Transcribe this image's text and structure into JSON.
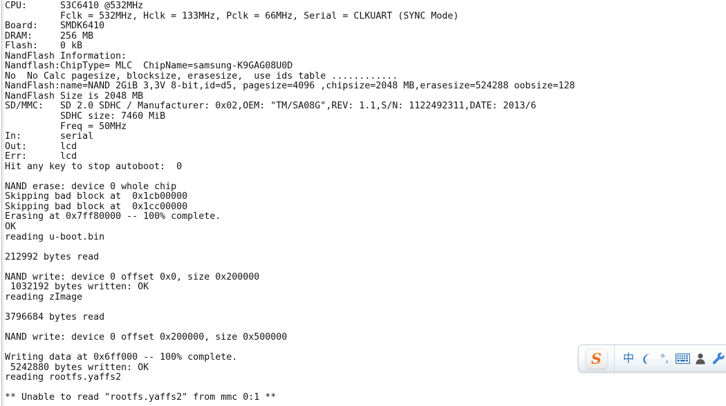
{
  "window": {
    "kind": "serial-terminal-console",
    "background_color": "#ffffff",
    "text_color": "#141414"
  },
  "console": {
    "lines": [
      "CPU:      S3C6410 @532MHz",
      "          Fclk = 532MHz, Hclk = 133MHz, Pclk = 66MHz, Serial = CLKUART (SYNC Mode)",
      "Board:    SMDK6410",
      "DRAM:     256 MB",
      "Flash:    0 kB",
      "NandFlash Information:",
      "Nandflash:ChipType= MLC  ChipName=samsung-K9GAG08U0D",
      "No  No Calc pagesize, blocksize, erasesize,  use ids table ............",
      "NandFlash:name=NAND 2GiB 3,3V 8-bit,id=d5, pagesize=4096 ,chipsize=2048 MB,erasesize=524288 oobsize=128",
      "NandFlash Size is 2048 MB",
      "SD/MMC:   SD 2.0 SDHC / Manufacturer: 0x02,OEM: \"TM/SA08G\",REV: 1.1,S/N: 1122492311,DATE: 2013/6",
      "          SDHC size: 7460 MiB",
      "          Freq = 50MHz",
      "In:       serial",
      "Out:      lcd",
      "Err:      lcd",
      "Hit any key to stop autoboot:  0",
      "",
      "NAND erase: device 0 whole chip",
      "Skipping bad block at  0x1cb00000",
      "Skipping bad block at  0x1cc00000",
      "Erasing at 0x7ff80000 -- 100% complete.",
      "OK",
      "reading u-boot.bin",
      "",
      "212992 bytes read",
      "",
      "NAND write: device 0 offset 0x0, size 0x200000",
      " 1032192 bytes written: OK",
      "reading zImage",
      "",
      "3796684 bytes read",
      "",
      "NAND write: device 0 offset 0x200000, size 0x500000",
      "",
      "Writing data at 0x6ff000 -- 100% complete.",
      " 5242880 bytes written: OK",
      "reading rootfs.yaffs2",
      "",
      "** Unable to read \"rootfs.yaffs2\" from mmc 0:1 **"
    ]
  },
  "ime_toolbar": {
    "name": "Sogou Pinyin input method toolbar",
    "logo_letter": "S",
    "accent_color": "#ee7023",
    "icon_color": "#2f72b8",
    "buttons": [
      {
        "name": "input-mode-chinese-button",
        "icon": "chinese-character-icon",
        "label": "中"
      },
      {
        "name": "moon-mode-button",
        "icon": "crescent-moon-icon",
        "label": ""
      },
      {
        "name": "punctuation-mode-button",
        "icon": "punctuation-icon",
        "label": "°,"
      },
      {
        "name": "soft-keyboard-button",
        "icon": "keyboard-icon",
        "label": ""
      },
      {
        "name": "user-account-button",
        "icon": "person-icon",
        "label": ""
      },
      {
        "name": "settings-button",
        "icon": "wrench-icon",
        "label": ""
      }
    ]
  }
}
